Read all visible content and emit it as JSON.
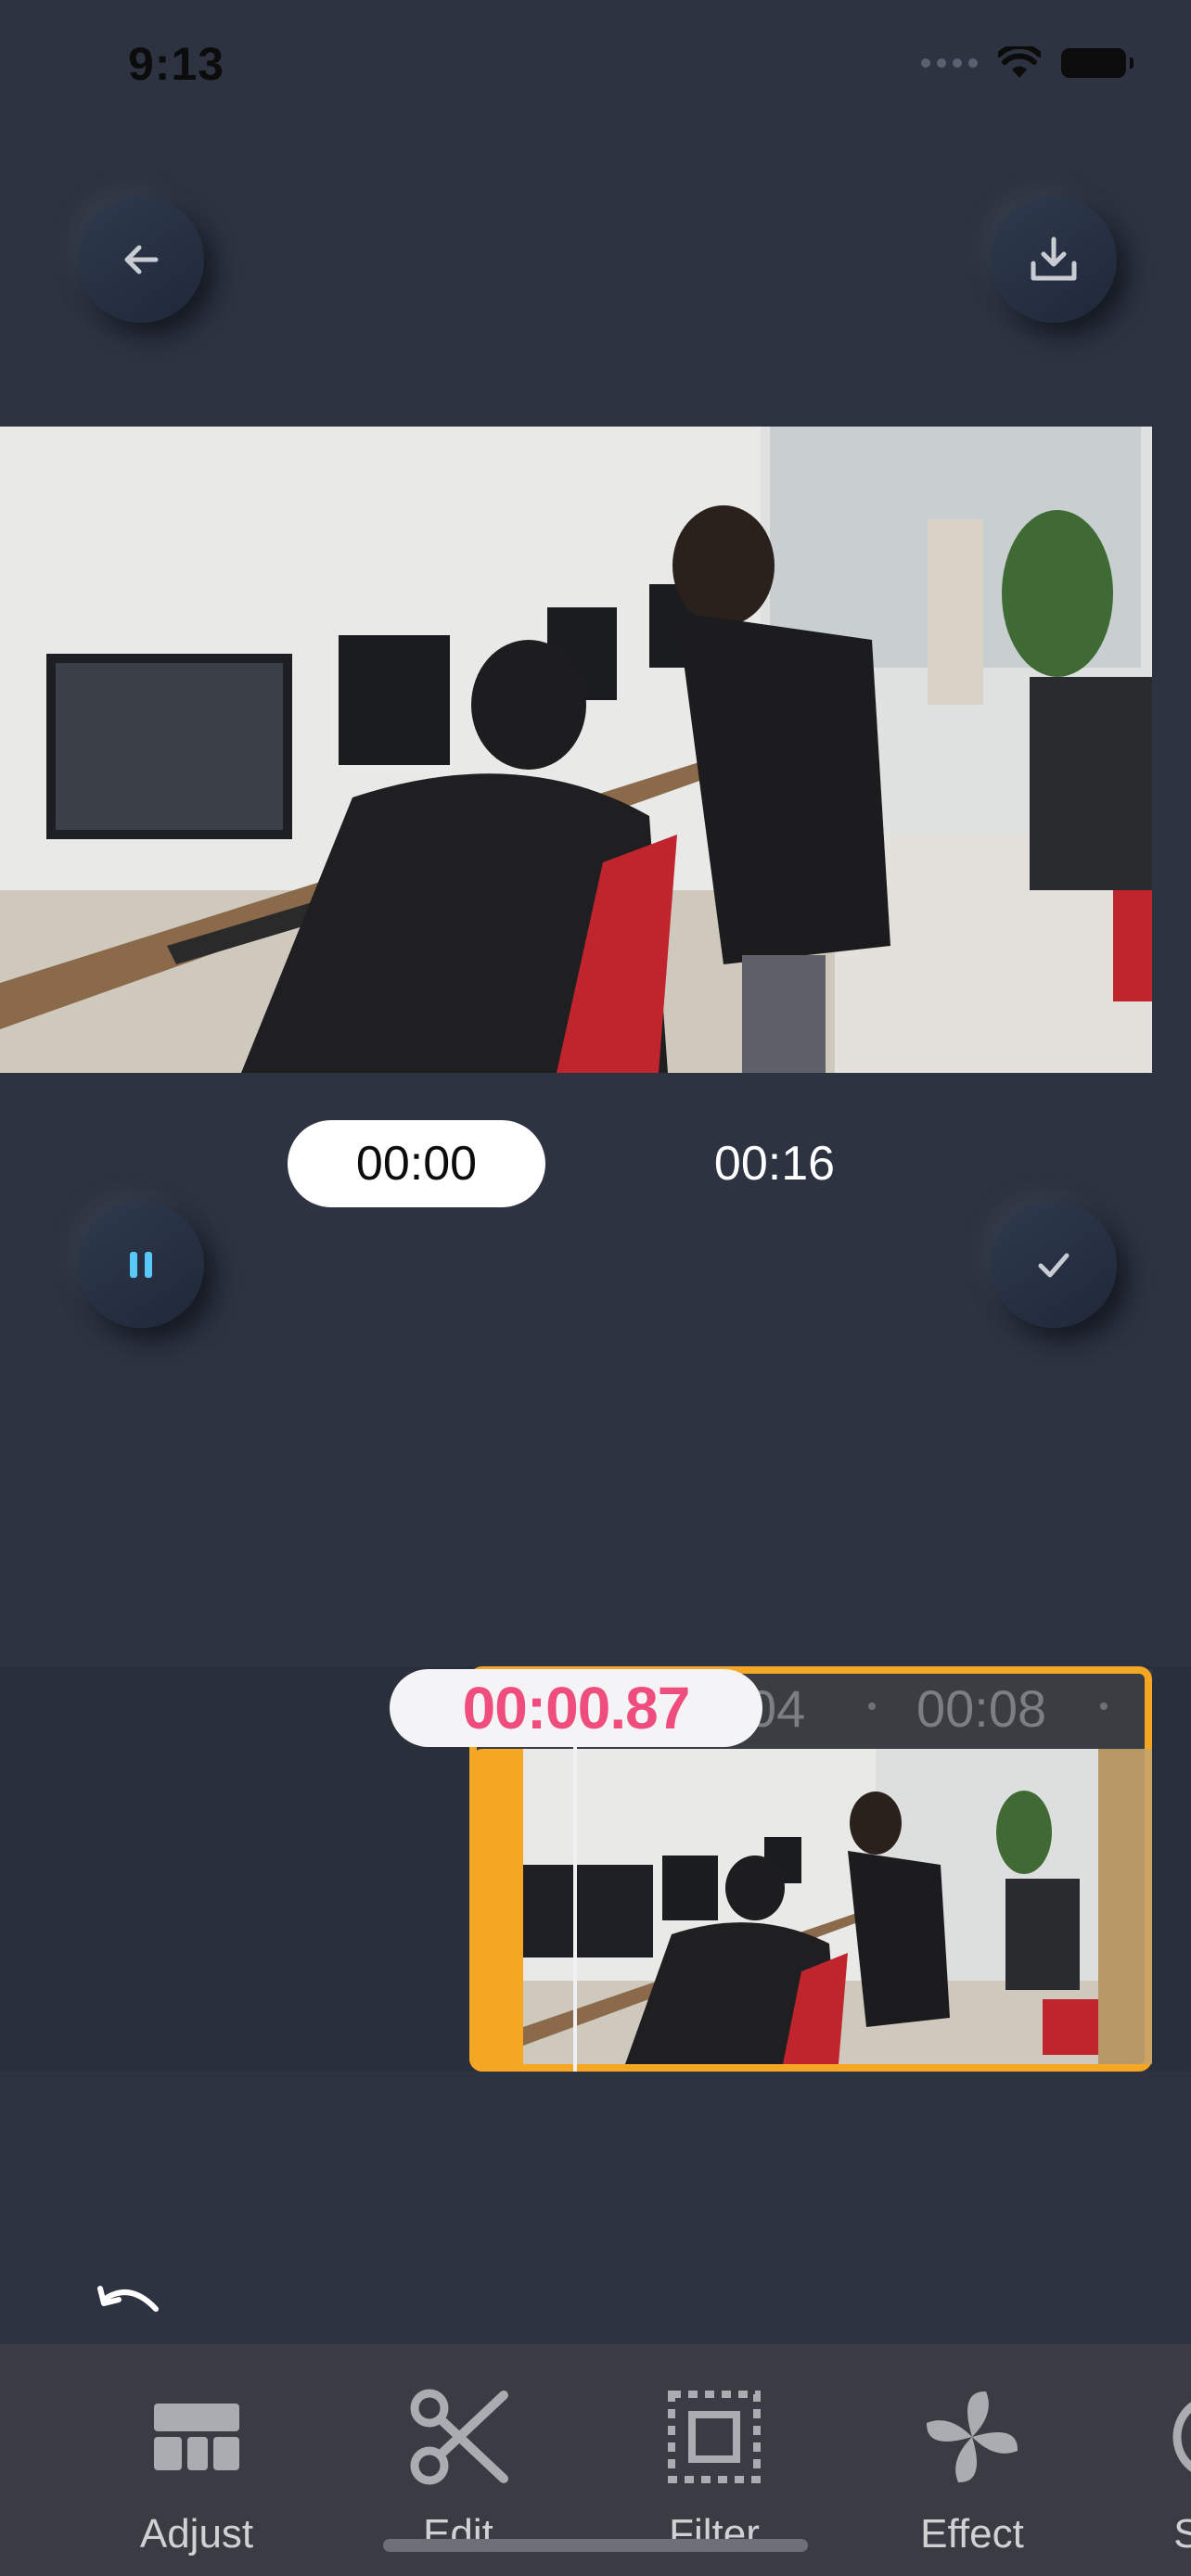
{
  "status_bar": {
    "time": "9:13"
  },
  "header": {
    "back_icon": "arrow-left-icon",
    "download_icon": "download-icon"
  },
  "player": {
    "current_time": "00:00",
    "total_time": "00:16",
    "play_pause_icon": "pause-icon",
    "confirm_icon": "checkmark-icon"
  },
  "timeline": {
    "playhead_time": "00:00.87",
    "ruler_labels": [
      "04",
      "00:08"
    ],
    "accent_color": "#f5a623",
    "playhead_color": "#ee4d7e"
  },
  "undo_icon": "undo-icon",
  "toolbar": {
    "items": [
      {
        "label": "Adjust",
        "icon": "adjust-icon"
      },
      {
        "label": "Edit",
        "icon": "scissors-icon"
      },
      {
        "label": "Filter",
        "icon": "filter-icon"
      },
      {
        "label": "Effect",
        "icon": "effect-pinwheel-icon"
      },
      {
        "label": "St",
        "icon": "sticker-icon"
      }
    ]
  },
  "colors": {
    "background": "#2d3340",
    "toolbar": "#393d43",
    "pause_accent": "#5ac8fa"
  }
}
